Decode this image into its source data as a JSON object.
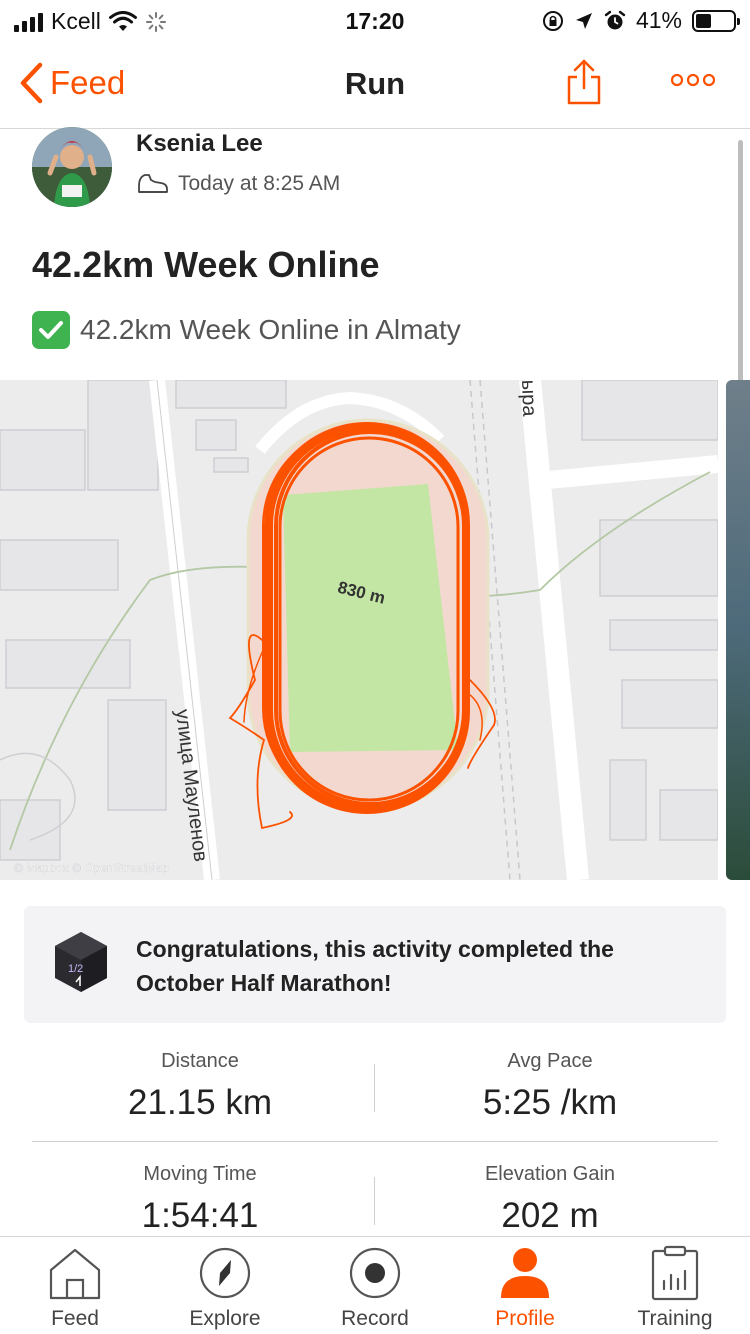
{
  "status_bar": {
    "carrier": "Kcell",
    "time": "17:20",
    "battery": "41%",
    "battery_level": 0.41
  },
  "nav": {
    "back_label": "Feed",
    "title": "Run",
    "icons": [
      "chevron-left-icon",
      "share-icon",
      "more-icon"
    ]
  },
  "activity": {
    "athlete_name": "Ksenia Lee",
    "timestamp": "Today at 8:25 AM",
    "title": "42.2km Week Online",
    "description": "42.2km Week Online in Almaty"
  },
  "map": {
    "distance_label": "830 m",
    "street_labels": [
      "улица Мауленов",
      "ыра"
    ],
    "attribution": "© Mapbox © OpenStreetMap",
    "route_color": "#fc5200",
    "field_color": "#c3e6a4"
  },
  "achievement": {
    "text": "Congratulations, this activity completed the October Half Marathon!",
    "badge_label": "1/2"
  },
  "stats": [
    {
      "label": "Distance",
      "value": "21.15 km"
    },
    {
      "label": "Avg Pace",
      "value": "5:25 /km"
    },
    {
      "label": "Moving Time",
      "value": "1:54:41"
    },
    {
      "label": "Elevation Gain",
      "value": "202 m"
    }
  ],
  "tabs": [
    {
      "label": "Feed",
      "icon": "home-icon"
    },
    {
      "label": "Explore",
      "icon": "compass-icon"
    },
    {
      "label": "Record",
      "icon": "record-icon"
    },
    {
      "label": "Profile",
      "icon": "profile-icon",
      "active": true
    },
    {
      "label": "Training",
      "icon": "training-icon"
    }
  ],
  "colors": {
    "accent": "#fc5200",
    "text": "#222222",
    "muted": "#555555"
  }
}
